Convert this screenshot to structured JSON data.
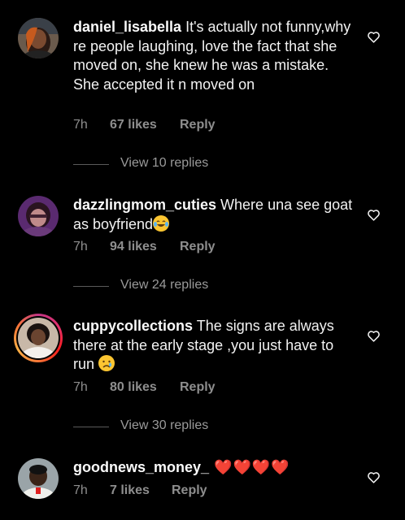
{
  "comments": [
    {
      "username": "daniel_lisabella",
      "text": " It's actually not funny,why re people laughing, love the fact that she moved on, she knew he was a mistake. She accepted it n moved on",
      "time": "7h",
      "likes": "67 likes",
      "reply_label": "Reply",
      "view_replies": "View 10 replies"
    },
    {
      "username": "dazzlingmom_cuties",
      "text": " Where una see goat as boyfriend",
      "emoji": "face-with-tears-of-joy",
      "time": "7h",
      "likes": "94 likes",
      "reply_label": "Reply",
      "view_replies": "View 24 replies"
    },
    {
      "username": "cuppycollections",
      "text": " The signs are always there at the early stage ,you just have to run ",
      "emoji": "crying-face",
      "time": "7h",
      "likes": "80 likes",
      "reply_label": "Reply",
      "view_replies": "View 30 replies"
    },
    {
      "username": "goodnews_money_",
      "text": " ❤️❤️❤️❤️",
      "time": "7h",
      "likes": "7 likes",
      "reply_label": "Reply"
    }
  ],
  "colors": {
    "background": "#000000",
    "text": "#f2f2f2",
    "meta": "#8e8e8e",
    "heart_red": "#e0202a"
  }
}
